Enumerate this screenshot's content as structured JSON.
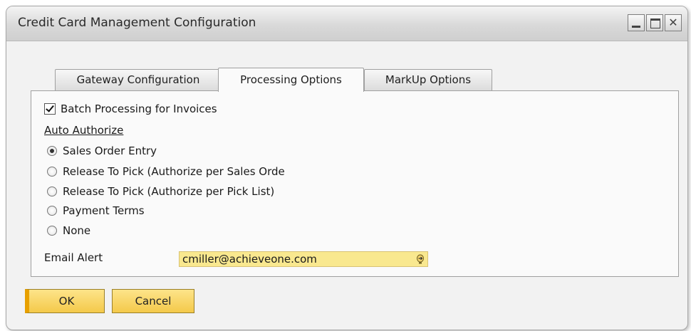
{
  "window": {
    "title": "Credit Card Management Configuration",
    "close_glyph": "✕"
  },
  "tabs": [
    {
      "label": "Gateway Configuration",
      "active": false
    },
    {
      "label": "Processing Options",
      "active": true
    },
    {
      "label": "MarkUp Options",
      "active": false
    }
  ],
  "processing": {
    "batch_label": "Batch Processing for Invoices",
    "batch_checked": true,
    "auto_authorize_heading": "Auto Authorize",
    "options": [
      {
        "label": "Sales Order Entry",
        "selected": true
      },
      {
        "label": "Release To Pick (Authorize per Sales Orde",
        "selected": false
      },
      {
        "label": "Release To Pick (Authorize per Pick List)",
        "selected": false
      },
      {
        "label": "Payment Terms",
        "selected": false
      },
      {
        "label": "None",
        "selected": false
      }
    ],
    "email_label": "Email Alert",
    "email_value": "cmiller@achieveone.com"
  },
  "buttons": {
    "ok": "OK",
    "cancel": "Cancel"
  },
  "colors": {
    "field_bg": "#f9e88f",
    "button_bg": "#f4c94a",
    "accent": "#e8a000"
  },
  "icons": {
    "email_field": "link-arrow-icon"
  }
}
